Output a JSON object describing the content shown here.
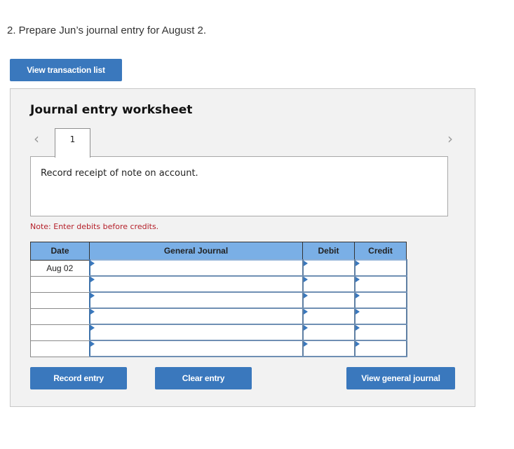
{
  "question": "2. Prepare Jun’s journal entry for August 2.",
  "buttons": {
    "view_transaction_list": "View transaction list",
    "record_entry": "Record entry",
    "clear_entry": "Clear entry",
    "view_general_journal": "View general journal"
  },
  "worksheet": {
    "title": "Journal entry worksheet",
    "nav": {
      "prev_icon": "chevron-left-icon",
      "next_icon": "chevron-right-icon"
    },
    "tabs": [
      {
        "label": "1",
        "active": true
      }
    ],
    "description": "Record receipt of note on account.",
    "note": "Note: Enter debits before credits."
  },
  "journal": {
    "columns": [
      "Date",
      "General Journal",
      "Debit",
      "Credit"
    ],
    "rows": [
      {
        "date": "Aug 02",
        "account": "",
        "debit": "",
        "credit": ""
      },
      {
        "date": "",
        "account": "",
        "debit": "",
        "credit": ""
      },
      {
        "date": "",
        "account": "",
        "debit": "",
        "credit": ""
      },
      {
        "date": "",
        "account": "",
        "debit": "",
        "credit": ""
      },
      {
        "date": "",
        "account": "",
        "debit": "",
        "credit": ""
      },
      {
        "date": "",
        "account": "",
        "debit": "",
        "credit": ""
      }
    ]
  },
  "colors": {
    "button_blue": "#3a78bd",
    "header_blue": "#7aafe6",
    "note_red": "#b5202a",
    "panel_bg": "#f2f2f2"
  }
}
